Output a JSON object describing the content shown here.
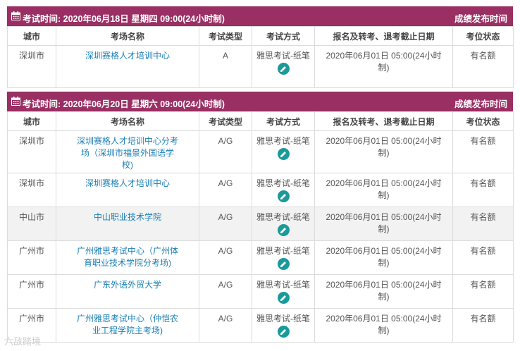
{
  "columns": [
    "城市",
    "考场名称",
    "考试类型",
    "考试方式",
    "报名及转考、退考截止日期",
    "考位状态"
  ],
  "sessions": [
    {
      "title": "考试时间: 2020年06月18日 星期四 09:00(24小时制)",
      "link": "成绩发布时间",
      "rows": [
        {
          "city": "深圳市",
          "venue_l1": "深圳赛格人才培训中心",
          "venue_l2": "",
          "venue_l3": "",
          "type": "A",
          "method": "雅思考试-纸笔",
          "deadline_l1": "2020年06月01日 05:00(24小时",
          "deadline_l2": "制)",
          "status": "有名额"
        }
      ]
    },
    {
      "title": "考试时间: 2020年06月20日 星期六 09:00(24小时制)",
      "link": "成绩发布时间",
      "rows": [
        {
          "city": "深圳市",
          "venue_l1": "深圳赛格人才培训中心分考",
          "venue_l2": "场（深圳市福景外国语学",
          "venue_l3": "校)",
          "type": "A/G",
          "method": "雅思考试-纸笔",
          "deadline_l1": "2020年06月01日 05:00(24小时",
          "deadline_l2": "制)",
          "status": "有名额"
        },
        {
          "city": "深圳市",
          "venue_l1": "深圳赛格人才培训中心",
          "venue_l2": "",
          "venue_l3": "",
          "type": "A/G",
          "method": "雅思考试-纸笔",
          "deadline_l1": "2020年06月01日 05:00(24小时",
          "deadline_l2": "制)",
          "status": "有名额"
        },
        {
          "city": "中山市",
          "venue_l1": "中山职业技术学院",
          "venue_l2": "",
          "venue_l3": "",
          "type": "A/G",
          "method": "雅思考试-纸笔",
          "deadline_l1": "2020年06月01日 05:00(24小时",
          "deadline_l2": "制)",
          "status": "有名额"
        },
        {
          "city": "广州市",
          "venue_l1": "广州雅思考试中心（广州体",
          "venue_l2": "育职业技术学院分考场)",
          "venue_l3": "",
          "type": "A/G",
          "method": "雅思考试-纸笔",
          "deadline_l1": "2020年06月01日 05:00(24小时",
          "deadline_l2": "制)",
          "status": "有名额"
        },
        {
          "city": "广州市",
          "venue_l1": "广东外语外贸大学",
          "venue_l2": "",
          "venue_l3": "",
          "type": "A/G",
          "method": "雅思考试-纸笔",
          "deadline_l1": "2020年06月01日 05:00(24小时",
          "deadline_l2": "制)",
          "status": "有名额"
        },
        {
          "city": "广州市",
          "venue_l1": "广州雅思考试中心（仲恺农",
          "venue_l2": "业工程学院主考场)",
          "venue_l3": "",
          "type": "A/G",
          "method": "雅思考试-纸笔",
          "deadline_l1": "2020年06月01日 05:00(24小时",
          "deadline_l2": "制)",
          "status": "有名额"
        }
      ]
    }
  ],
  "watermark": "六敌踏境",
  "icons": {
    "header": "calendar-icon",
    "method": "pencil-icon"
  },
  "colors": {
    "header_bg": "#9a2f63",
    "link": "#1a7fb5",
    "pencil_bg": "#1a9a9a",
    "highlight_row": "#f2f2f2"
  }
}
